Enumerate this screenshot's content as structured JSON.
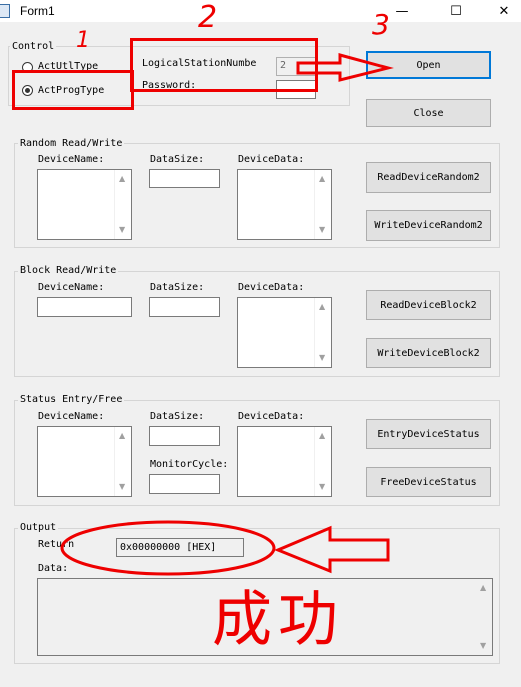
{
  "window": {
    "title": "Form1",
    "minimize": "—",
    "maximize": "☐",
    "close": "✕"
  },
  "control": {
    "legend": "Control",
    "radio_util": "ActUtlType",
    "radio_prog": "ActProgType",
    "station_label": "LogicalStationNumbe",
    "station_value": "2",
    "password_label": "Password:",
    "open_label": "Open",
    "close_label": "Close"
  },
  "random": {
    "legend": "Random Read/Write",
    "device_name": "DeviceName:",
    "data_size": "DataSize:",
    "device_data": "DeviceData:",
    "read_button": "ReadDeviceRandom2",
    "write_button": "WriteDeviceRandom2"
  },
  "block": {
    "legend": "Block Read/Write",
    "device_name": "DeviceName:",
    "data_size": "DataSize:",
    "device_data": "DeviceData:",
    "read_button": "ReadDeviceBlock2",
    "write_button": "WriteDeviceBlock2"
  },
  "status": {
    "legend": "Status Entry/Free",
    "device_name": "DeviceName:",
    "data_size": "DataSize:",
    "device_data": "DeviceData:",
    "monitor_cycle": "MonitorCycle:",
    "entry_button": "EntryDeviceStatus",
    "free_button": "FreeDeviceStatus"
  },
  "output": {
    "legend": "Output",
    "return_label": "Return",
    "return_value": "0x00000000 [HEX]",
    "data_label": "Data:"
  },
  "annotations": {
    "num1": "1",
    "num2": "2",
    "num3": "3",
    "success_text": "成功"
  },
  "colors": {
    "annotation_red": "#e00000",
    "focus_blue": "#0078d7"
  },
  "icons": {
    "scroll_up": "▲",
    "scroll_down": "▼"
  }
}
